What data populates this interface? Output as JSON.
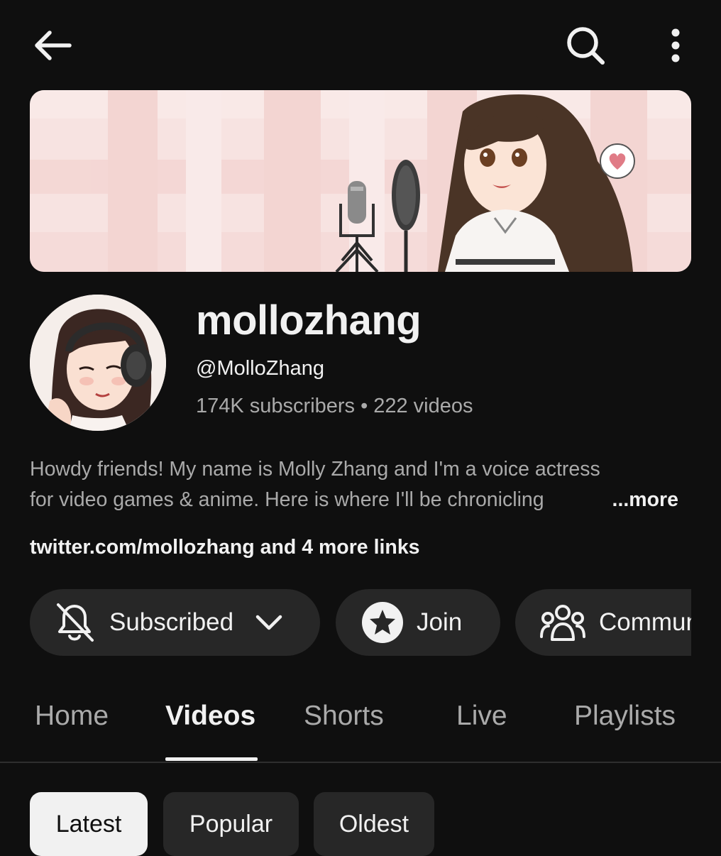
{
  "header": {
    "back_icon": "arrow-left-icon",
    "search_icon": "search-icon",
    "more_icon": "more-vert-icon"
  },
  "channel": {
    "name": "mollozhang",
    "handle": "@MolloZhang",
    "subscribers": "174K subscribers",
    "separator": "•",
    "videos": "222 videos",
    "description_line1": "Howdy friends! My name is Molly Zhang and I'm a voice actress",
    "description_line2": "for video games & anime. Here is where I'll be chronicling",
    "more_label": "...more",
    "links": "twitter.com/mollozhang and 4 more links"
  },
  "actions": {
    "subscribed_label": "Subscribed",
    "join_label": "Join",
    "community_label": "Community"
  },
  "tabs": [
    {
      "label": "Home",
      "active": false
    },
    {
      "label": "Videos",
      "active": true
    },
    {
      "label": "Shorts",
      "active": false
    },
    {
      "label": "Live",
      "active": false
    },
    {
      "label": "Playlists",
      "active": false
    }
  ],
  "chips": [
    {
      "label": "Latest",
      "selected": true
    },
    {
      "label": "Popular",
      "selected": false
    },
    {
      "label": "Oldest",
      "selected": false
    }
  ],
  "colors": {
    "background": "#0f0f0f",
    "surface": "#272727",
    "text_primary": "#f1f1f1",
    "text_secondary": "#aaaaaa"
  }
}
